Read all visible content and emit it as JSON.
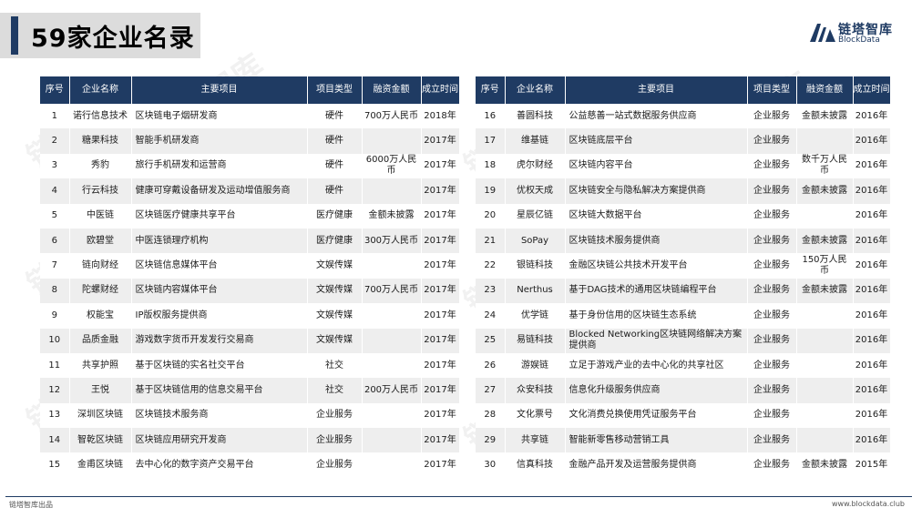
{
  "title": "59家企业名录",
  "logo": {
    "cn": "链塔智库",
    "en": "BlockData"
  },
  "columns": [
    "序号",
    "企业名称",
    "主要项目",
    "项目类型",
    "融资金额",
    "成立时间"
  ],
  "left_rows": [
    [
      "1",
      "诺行信息技术",
      "区块链电子烟研发商",
      "硬件",
      "700万人民币",
      "2018年"
    ],
    [
      "2",
      "糖果科技",
      "智能手机研发商",
      "硬件",
      "",
      "2017年"
    ],
    [
      "3",
      "秀豹",
      "旅行手机研发和运营商",
      "硬件",
      "6000万人民币",
      "2017年"
    ],
    [
      "4",
      "行云科技",
      "健康可穿戴设备研发及运动增值服务商",
      "硬件",
      "",
      "2017年"
    ],
    [
      "5",
      "中医链",
      "区块链医疗健康共享平台",
      "医疗健康",
      "金额未披露",
      "2017年"
    ],
    [
      "6",
      "欧碧堂",
      "中医连锁理疗机构",
      "医疗健康",
      "300万人民币",
      "2017年"
    ],
    [
      "7",
      "链向财经",
      "区块链信息媒体平台",
      "文娱传媒",
      "",
      "2017年"
    ],
    [
      "8",
      "陀螺财经",
      "区块链内容媒体平台",
      "文娱传媒",
      "700万人民币",
      "2017年"
    ],
    [
      "9",
      "权能宝",
      "IP版权服务提供商",
      "文娱传媒",
      "",
      "2017年"
    ],
    [
      "10",
      "品质金融",
      "游戏数字货币开发发行交易商",
      "文娱传媒",
      "",
      "2017年"
    ],
    [
      "11",
      "共享护照",
      "基于区块链的实名社交平台",
      "社交",
      "",
      "2017年"
    ],
    [
      "12",
      "王悦",
      "基于区块链信用的信息交易平台",
      "社交",
      "200万人民币",
      "2017年"
    ],
    [
      "13",
      "深圳区块链",
      "区块链技术服务商",
      "企业服务",
      "",
      "2017年"
    ],
    [
      "14",
      "智乾区块链",
      "区块链应用研究开发商",
      "企业服务",
      "",
      "2017年"
    ],
    [
      "15",
      "金甫区块链",
      "去中心化的数字资产交易平台",
      "企业服务",
      "",
      "2017年"
    ]
  ],
  "right_rows": [
    [
      "16",
      "善圆科技",
      "公益慈善一站式数据服务供应商",
      "企业服务",
      "金额未披露",
      "2016年"
    ],
    [
      "17",
      "维基链",
      "区块链底层平台",
      "企业服务",
      "",
      "2016年"
    ],
    [
      "18",
      "虎尔财经",
      "区块链内容平台",
      "企业服务",
      "数千万人民币",
      "2016年"
    ],
    [
      "19",
      "优权天成",
      "区块链安全与隐私解决方案提供商",
      "企业服务",
      "金额未披露",
      "2016年"
    ],
    [
      "20",
      "星辰亿链",
      "区块链大数据平台",
      "企业服务",
      "",
      "2016年"
    ],
    [
      "21",
      "SoPay",
      "区块链技术服务提供商",
      "企业服务",
      "金额未披露",
      "2016年"
    ],
    [
      "22",
      "银链科技",
      "金融区块链公共技术开发平台",
      "企业服务",
      "150万人民币",
      "2016年"
    ],
    [
      "23",
      "Nerthus",
      "基于DAG技术的通用区块链编程平台",
      "企业服务",
      "金额未披露",
      "2016年"
    ],
    [
      "24",
      "优学链",
      "基于身份信用的区块链生态系统",
      "企业服务",
      "",
      "2016年"
    ],
    [
      "25",
      "易链科技",
      "Blocked Networking区块链网络解决方案提供商",
      "企业服务",
      "",
      "2016年"
    ],
    [
      "26",
      "游娱链",
      "立足于游戏产业的去中心化的共享社区",
      "企业服务",
      "",
      "2016年"
    ],
    [
      "27",
      "众安科技",
      "信息化升级服务供应商",
      "企业服务",
      "",
      "2016年"
    ],
    [
      "28",
      "文化票号",
      "文化消费兑换使用凭证服务平台",
      "企业服务",
      "",
      "2016年"
    ],
    [
      "29",
      "共享链",
      "智能新零售移动营销工具",
      "企业服务",
      "",
      "2016年"
    ],
    [
      "30",
      "信真科技",
      "金融产品开发及运营服务提供商",
      "企业服务",
      "金额未披露",
      "2015年"
    ]
  ],
  "watermark": "链塔智库",
  "footer": {
    "left": "链塔智库出品",
    "right": "www.blockdata.club"
  },
  "colors": {
    "header": "#1f3b63",
    "stripe": "#eeeeee",
    "title_bg": "#dcdcdc"
  },
  "icons": {
    "logo": "blockdata-logo-icon"
  }
}
